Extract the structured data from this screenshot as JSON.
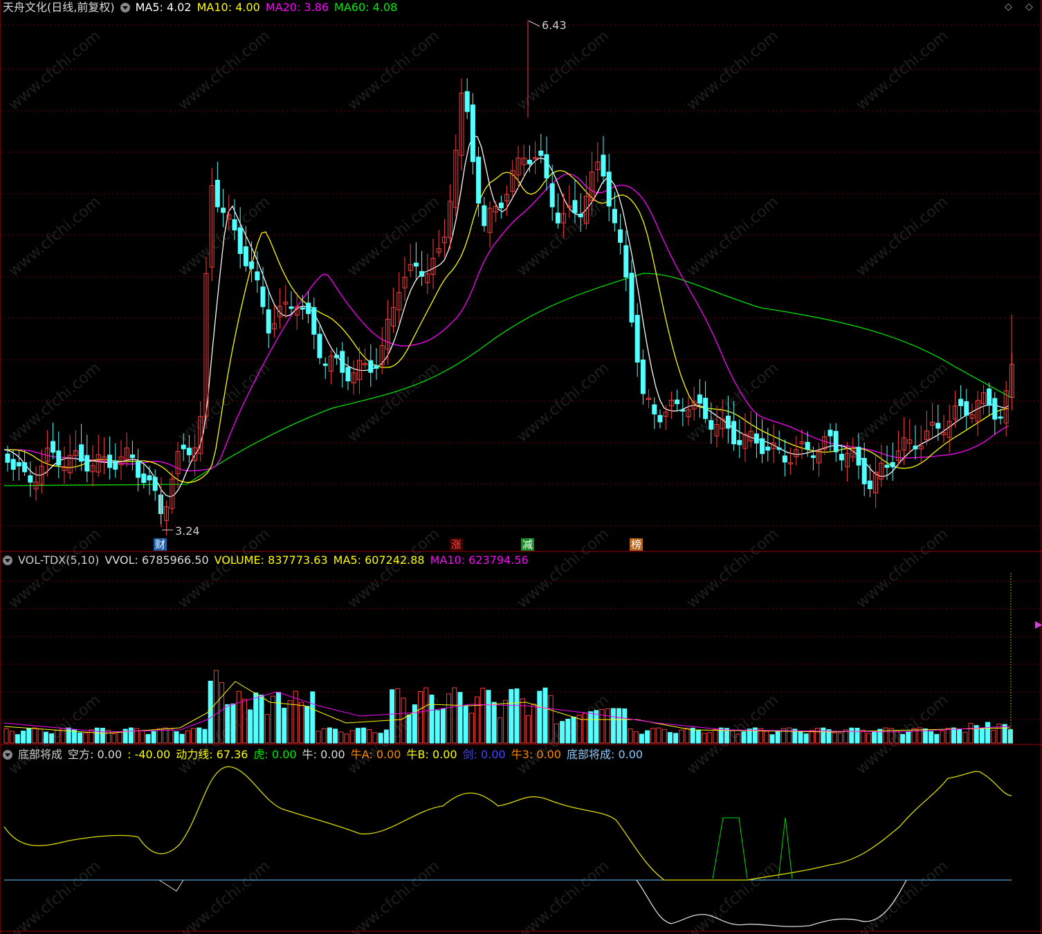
{
  "main_header": {
    "title": "天舟文化(日线,前复权)",
    "ma5": "MA5: 4.02",
    "ma10": "MA10: 4.00",
    "ma20": "MA20: 3.86",
    "ma60": "MA60: 4.08"
  },
  "annotations": {
    "high": "6.43",
    "low": "3.24"
  },
  "event_tags": [
    {
      "label": "财",
      "color": "#1f5fa8"
    },
    {
      "label": "涨",
      "color": "#c0202a"
    },
    {
      "label": "减",
      "color": "#1c8f2a"
    },
    {
      "label": "榜",
      "color": "#b5651d"
    }
  ],
  "vol_header": {
    "name": "VOL-TDX(5,10)",
    "vvol": "VVOL: 6785966.50",
    "volume": "VOLUME: 837773.63",
    "ma5": "MA5: 607242.88",
    "ma10": "MA10: 623794.56"
  },
  "ind_header": {
    "name": "底部将成",
    "kong": "空方: 0.00",
    "neg": ": -40.00",
    "dongli": "动力线: 67.36",
    "hu": "虎: 0.00",
    "niu": "牛: 0.00",
    "niuA": "牛A: 0.00",
    "niuB": "牛B: 0.00",
    "jian": "剑: 0.00",
    "niu3": "牛3: 0.00",
    "dibu": "底部将成: 0.00"
  },
  "colors": {
    "up": "#ff3c3c",
    "down": "#54ffff",
    "ma5": "#ffffff",
    "ma10": "#ffff00",
    "ma20": "#ff00ff",
    "ma60": "#00e000",
    "grid": "#7a0000"
  },
  "controls": {
    "diamond_icon": "◇",
    "arrow_icon": "▶"
  }
}
